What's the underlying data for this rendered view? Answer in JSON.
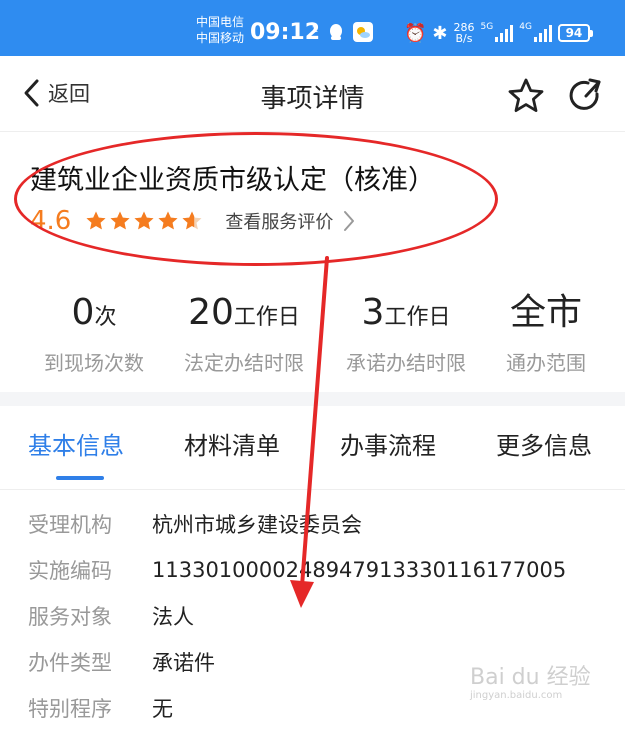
{
  "status_bar": {
    "carrier_top": "中国电信",
    "carrier_bottom": "中国移动",
    "time": "09:12",
    "net_speed_value": "286",
    "net_speed_unit": "B/s",
    "network_a": "5G",
    "network_b": "4G",
    "battery": "94"
  },
  "nav": {
    "back_label": "返回",
    "title": "事项详情"
  },
  "item": {
    "title": "建筑业企业资质市级认定（核准）",
    "score": "4.6",
    "stars_filled_fraction": 0.92,
    "review_link": "查看服务评价"
  },
  "stats": [
    {
      "value": "0",
      "unit": "次",
      "label": "到现场次数"
    },
    {
      "value": "20",
      "unit": "工作日",
      "label": "法定办结时限"
    },
    {
      "value": "3",
      "unit": "工作日",
      "label": "承诺办结时限"
    },
    {
      "value": "全市",
      "unit": "",
      "label": "通办范围"
    }
  ],
  "tabs": [
    {
      "label": "基本信息",
      "active": true
    },
    {
      "label": "材料清单",
      "active": false
    },
    {
      "label": "办事流程",
      "active": false
    },
    {
      "label": "更多信息",
      "active": false
    }
  ],
  "info_rows": [
    {
      "label": "受理机构",
      "value": "杭州市城乡建设委员会"
    },
    {
      "label": "实施编码",
      "value": "11330100002489479133301161770​05"
    },
    {
      "label": "服务对象",
      "value": "法人"
    },
    {
      "label": "办件类型",
      "value": "承诺件"
    },
    {
      "label": "特别程序",
      "value": "无"
    }
  ],
  "watermark": {
    "brand": "Bai du 经验",
    "url": "jingyan.baidu.com"
  },
  "colors": {
    "status_bar": "#2f8cf0",
    "accent": "#2f7fe8",
    "rating": "#f57c1f",
    "annotation": "#e52828"
  }
}
